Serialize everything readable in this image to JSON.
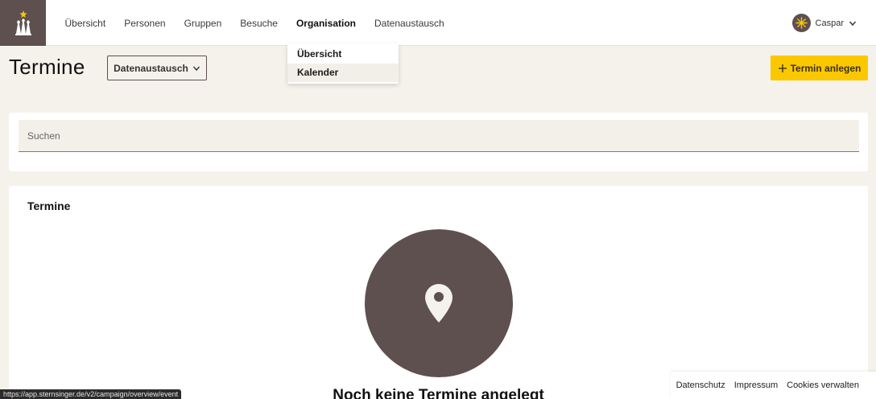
{
  "nav": {
    "items": [
      {
        "label": "Übersicht"
      },
      {
        "label": "Personen"
      },
      {
        "label": "Gruppen"
      },
      {
        "label": "Besuche"
      },
      {
        "label": "Organisation"
      },
      {
        "label": "Datenaustausch"
      }
    ],
    "active": "Organisation"
  },
  "user": {
    "name": "Caspar"
  },
  "dropdown": {
    "items": [
      {
        "label": "Übersicht"
      },
      {
        "label": "Kalender"
      }
    ]
  },
  "page": {
    "title": "Termine",
    "filter_label": "Datenaustausch",
    "create_label": "Termin anlegen"
  },
  "search": {
    "placeholder": "Suchen"
  },
  "events": {
    "title": "Termine",
    "empty_text": "Noch keine Termine angelegt"
  },
  "footer": {
    "links": [
      "Datenschutz",
      "Impressum",
      "Cookies verwalten"
    ]
  },
  "statusbar": {
    "url": "https://app.sternsinger.de/v2/campaign/overview/event"
  },
  "colors": {
    "brand": "#5e504f",
    "accent": "#fbc800",
    "background": "#f4f2ea"
  }
}
